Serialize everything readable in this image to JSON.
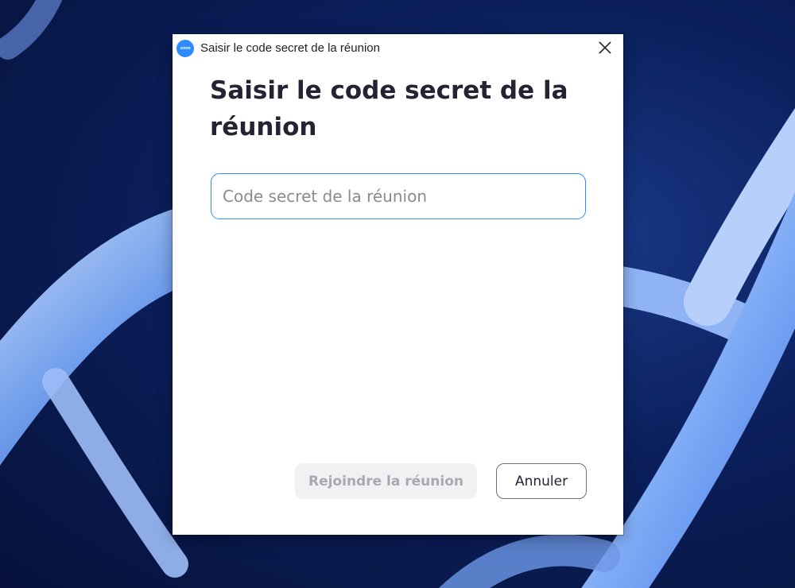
{
  "window": {
    "title": "Saisir le code secret de la réunion",
    "app_logo_text": "zoom",
    "close_icon": "close-icon"
  },
  "dialog": {
    "heading": "Saisir le code secret de la réunion",
    "passcode": {
      "value": "",
      "placeholder": "Code secret de la réunion"
    },
    "join_label": "Rejoindre la réunion",
    "join_enabled": false,
    "cancel_label": "Annuler"
  },
  "colors": {
    "accent": "#2d8cff",
    "join_disabled_bg": "#f1f1f4",
    "join_disabled_text": "#a8a8b0",
    "heading_text": "#232333"
  },
  "background": {
    "image": "blue DNA double helix wallpaper"
  }
}
